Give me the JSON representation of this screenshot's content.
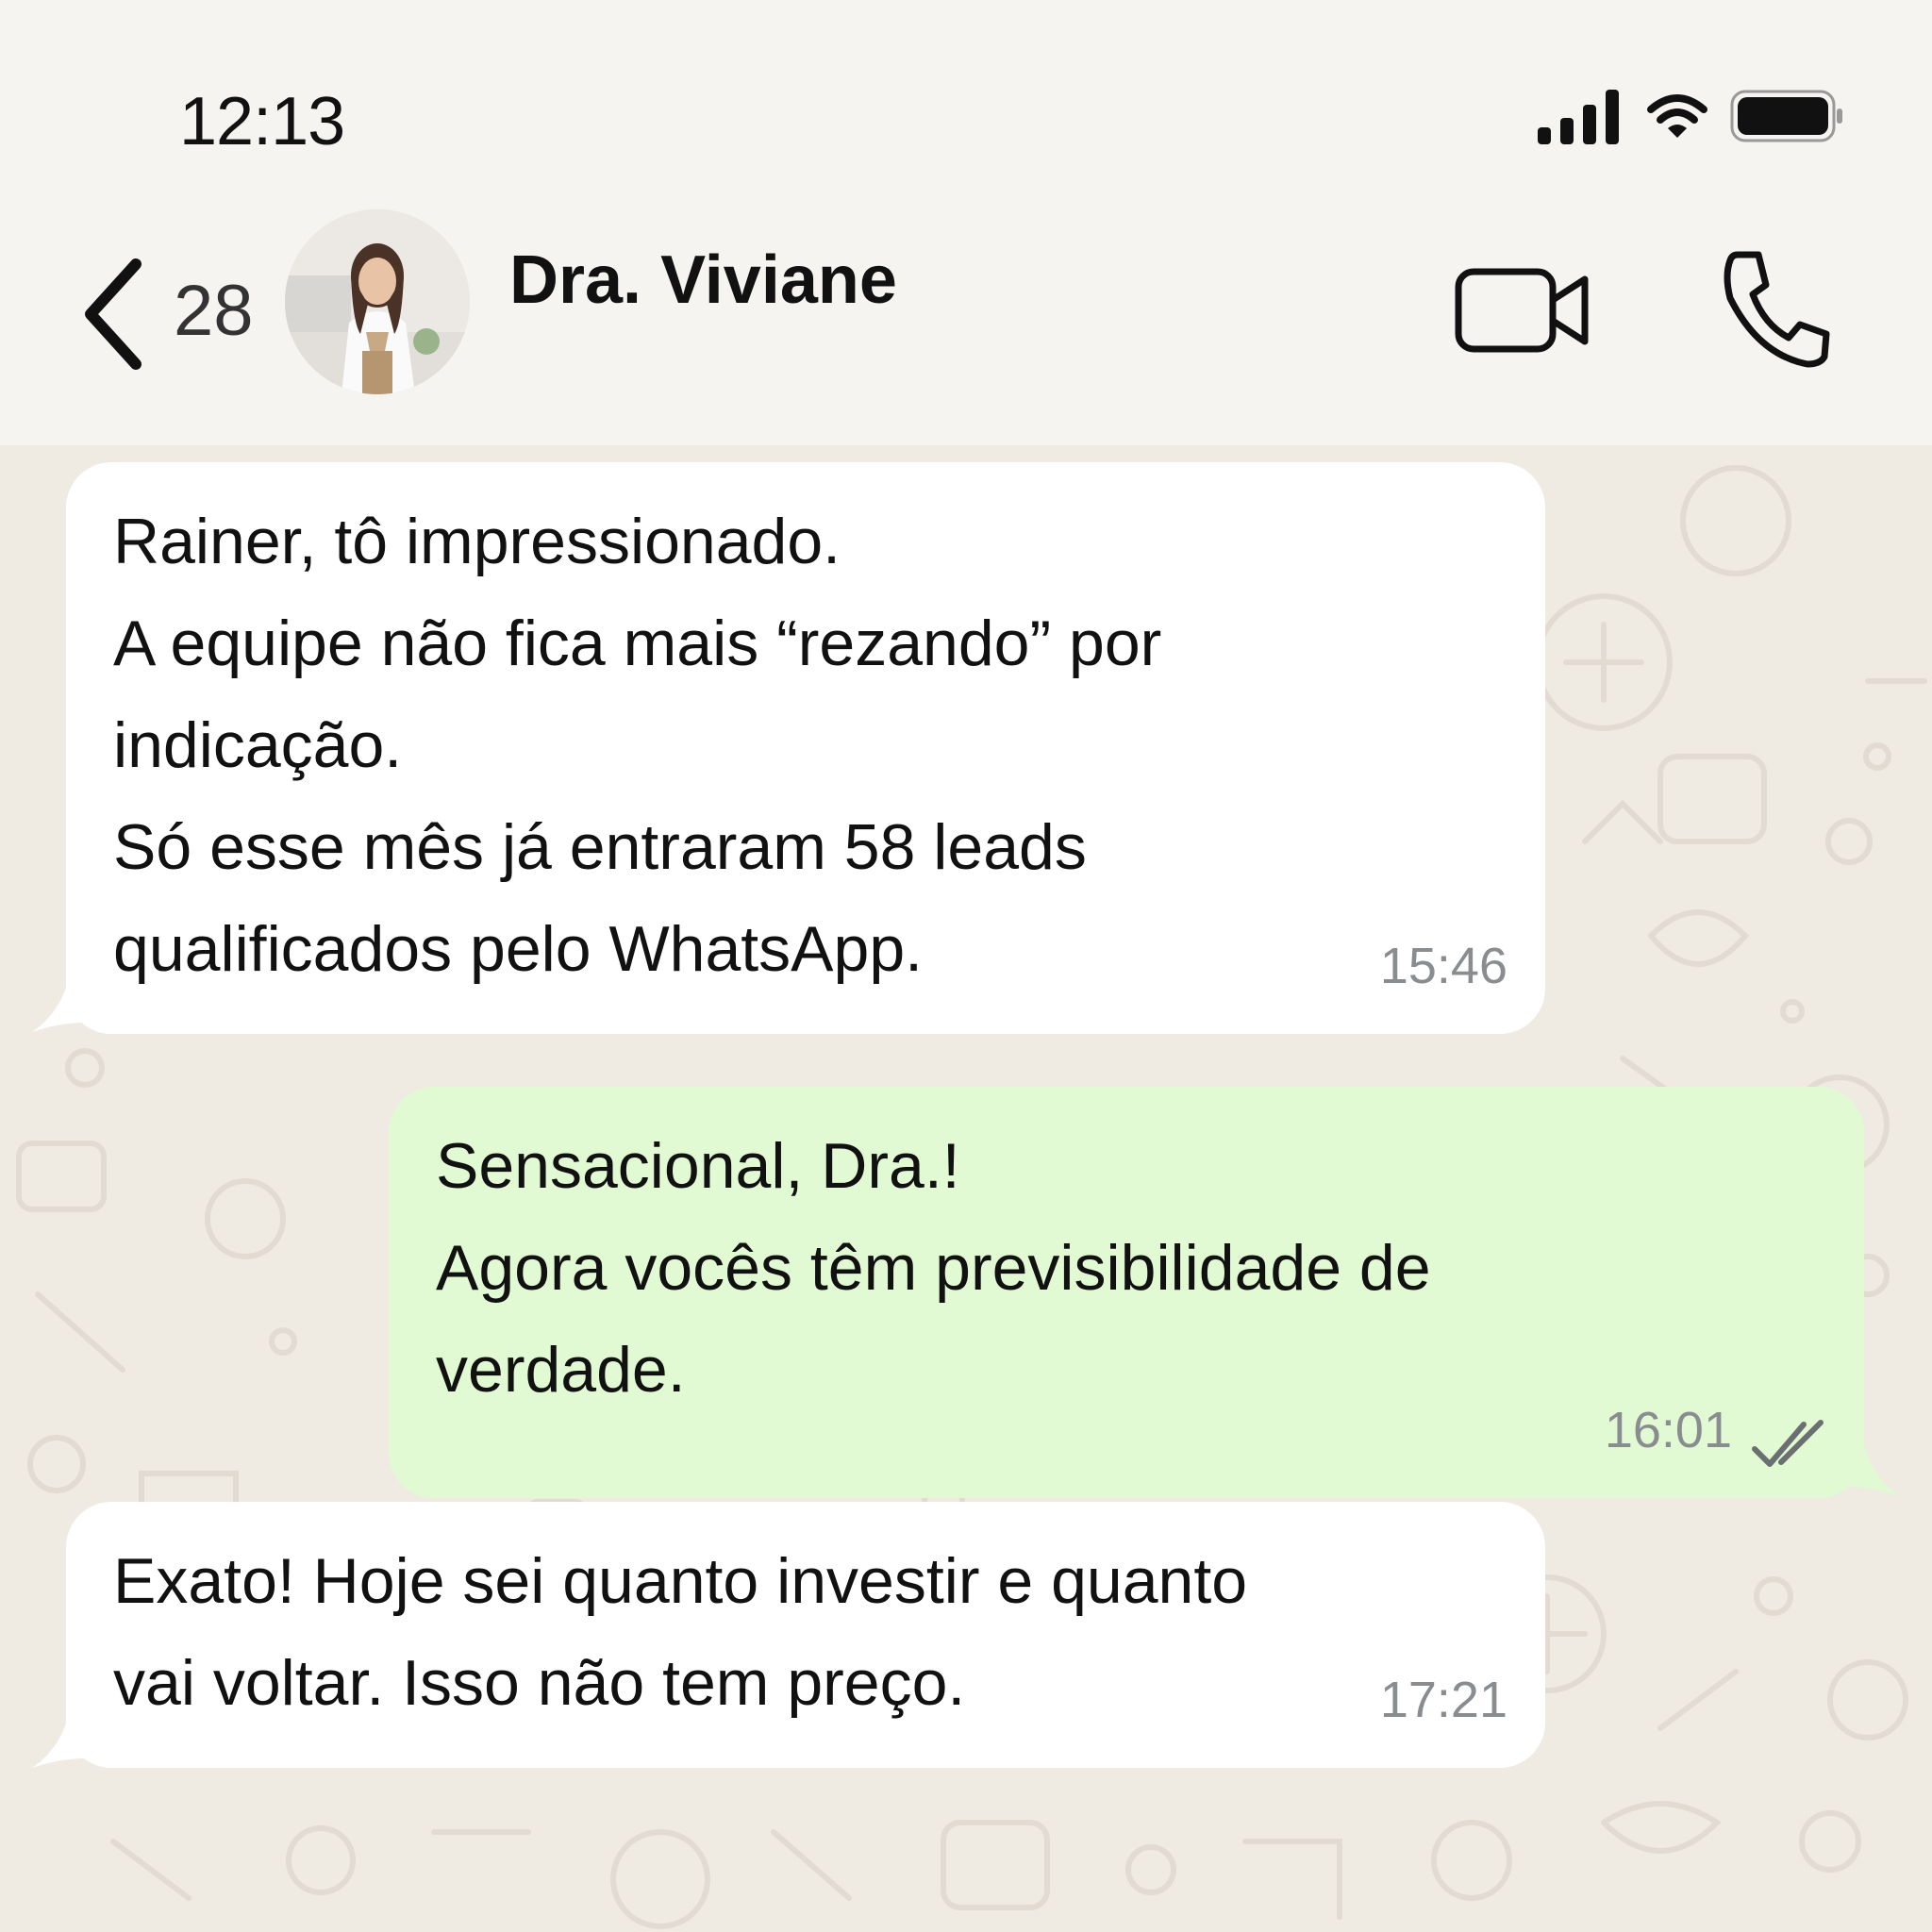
{
  "status_bar": {
    "time": "12:13",
    "icons": [
      "signal-icon",
      "wifi-icon",
      "battery-icon"
    ]
  },
  "header": {
    "back_count": "28",
    "contact_name": "Dra. Viviane",
    "icons": [
      "chevron-left-icon",
      "video-camera-icon",
      "phone-icon"
    ]
  },
  "messages": [
    {
      "direction": "incoming",
      "lines": [
        "Rainer, tô impressionado.",
        "A equipe não fica mais “rezando” por",
        "indicação.",
        "Só esse mês já entraram 58 leads",
        "qualificados pelo WhatsApp."
      ],
      "time": "15:46"
    },
    {
      "direction": "outgoing",
      "lines": [
        "Sensacional, Dra.!",
        "Agora vocês têm previsibilidade de",
        "verdade."
      ],
      "time": "16:01",
      "status": "read"
    },
    {
      "direction": "incoming",
      "lines": [
        "Exato! Hoje sei quanto investir e quanto",
        "vai voltar. Isso não tem preço."
      ],
      "time": "17:21"
    }
  ],
  "colors": {
    "incoming_bubble": "#ffffff",
    "outgoing_bubble": "#e1fad3",
    "chat_background": "#efeae2",
    "header_background": "#f5f4f1",
    "read_ticks": "#6b6f72"
  }
}
